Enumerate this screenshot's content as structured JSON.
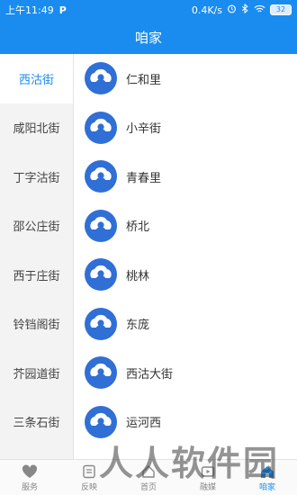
{
  "status": {
    "time": "上午11:49",
    "app_badge": "P",
    "speed": "0.4K/s",
    "battery": "32"
  },
  "title": "咱家",
  "sidebar": {
    "items": [
      {
        "label": "西沽街",
        "active": true
      },
      {
        "label": "咸阳北街",
        "active": false
      },
      {
        "label": "丁字沽街",
        "active": false
      },
      {
        "label": "邵公庄街",
        "active": false
      },
      {
        "label": "西于庄街",
        "active": false
      },
      {
        "label": "铃铛阁街",
        "active": false
      },
      {
        "label": "芥园道街",
        "active": false
      },
      {
        "label": "三条石街",
        "active": false
      }
    ]
  },
  "list": {
    "items": [
      {
        "label": "仁和里"
      },
      {
        "label": "小辛街"
      },
      {
        "label": "青春里"
      },
      {
        "label": "桥北"
      },
      {
        "label": "桃林"
      },
      {
        "label": "东庞"
      },
      {
        "label": "西沽大街"
      },
      {
        "label": "运河西"
      }
    ]
  },
  "bottom_nav": {
    "items": [
      {
        "label": "服务",
        "icon": "heart-icon",
        "active": false
      },
      {
        "label": "反映",
        "icon": "report-icon",
        "active": false
      },
      {
        "label": "首页",
        "icon": "home-icon",
        "active": false
      },
      {
        "label": "融媒",
        "icon": "media-icon",
        "active": false
      },
      {
        "label": "咱家",
        "icon": "family-icon",
        "active": true
      }
    ]
  },
  "watermark": "人人软件园",
  "colors": {
    "primary": "#1a8cf0",
    "avatar": "#2f6fd6",
    "sidebar_bg": "#f3f3f3"
  }
}
